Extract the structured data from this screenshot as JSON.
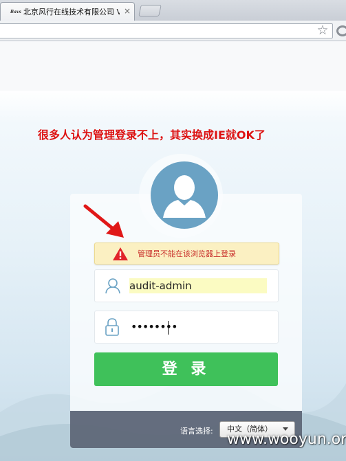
{
  "browser": {
    "favicon_text": "Bavs",
    "tab_title": "北京风行在线技术有限公司 V",
    "tab_close": "×",
    "star_glyph": "☆"
  },
  "annotation": {
    "text": "很多人认为管理登录不上，其实换成IE就OK了",
    "color": "#dd1111"
  },
  "login": {
    "warning_text": "管理员不能在该浏览器上登录",
    "username_value": "audit-admin",
    "password_mask": "••••••••",
    "login_button_label": "登 录",
    "language_label": "语言选择:",
    "language_selected": "中文（简体）"
  },
  "watermark": "www.wooyun.org",
  "colors": {
    "accent_green": "#3fc15a",
    "warning_red": "#c9302c",
    "avatar_blue": "#6aa2c4"
  },
  "icons": [
    "star-icon",
    "menu-icon",
    "user-icon",
    "lock-icon",
    "warning-icon",
    "arrow-annotation",
    "avatar-icon"
  ]
}
